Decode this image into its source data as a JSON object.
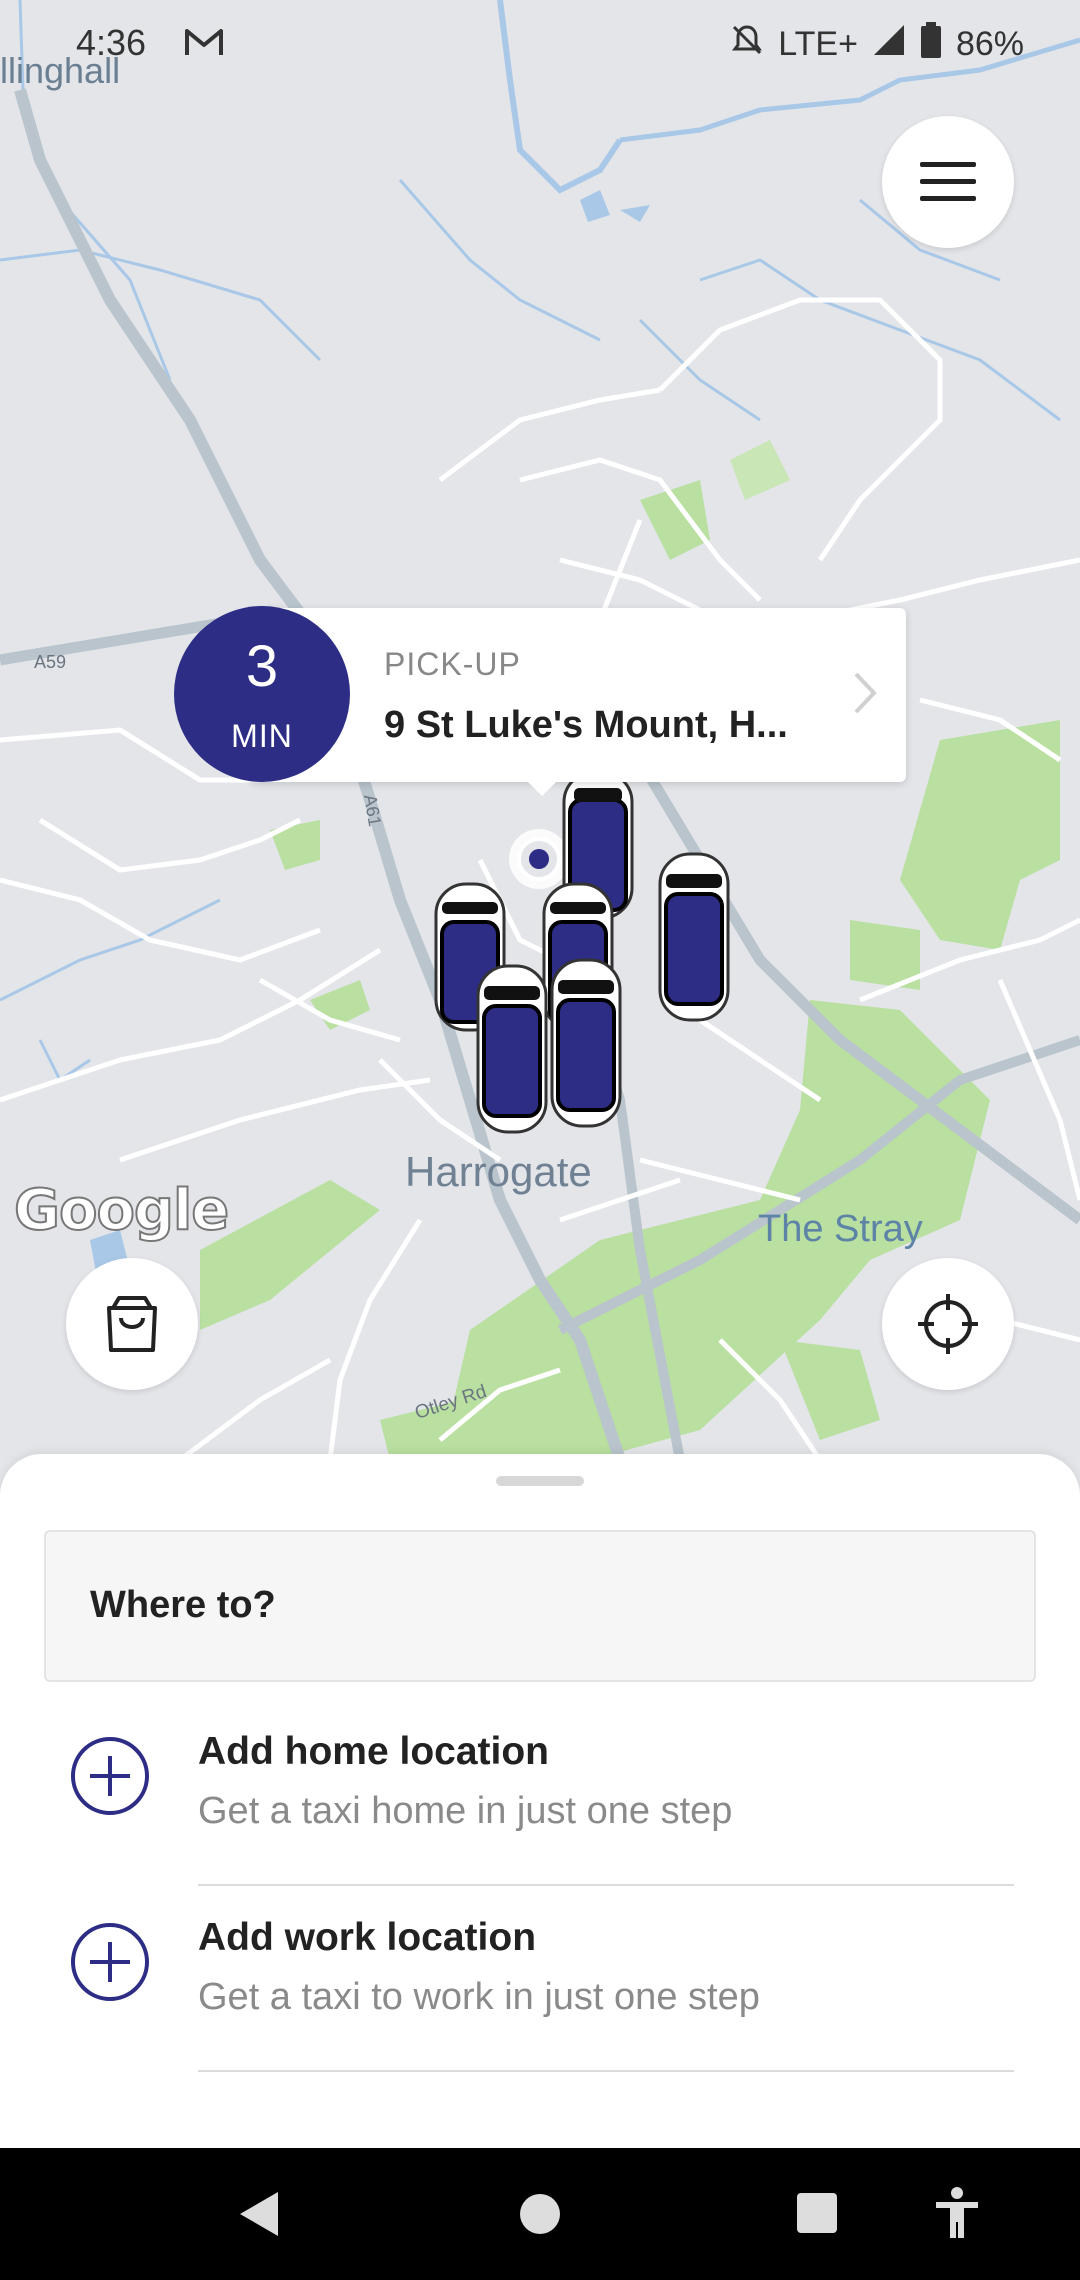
{
  "status_bar": {
    "time": "4:36",
    "gmail_icon": "gmail-icon",
    "network": "LTE+",
    "battery": "86%"
  },
  "map": {
    "labels": {
      "town": "Harrogate",
      "park": "The Stray",
      "village": "llinghall",
      "road_a59": "A59",
      "road_a61": "A61",
      "road_otley": "Otley Rd"
    },
    "attribution": "Google",
    "colors": {
      "land": "#e3e5e9",
      "park": "#b9e0a0",
      "water": "#a9c8e8",
      "road": "#ffffff",
      "major_road": "#b9c4cc"
    }
  },
  "pickup": {
    "eta_value": "3",
    "eta_unit": "MIN",
    "label": "PICK-UP",
    "address": "9 St Luke's Mount, H..."
  },
  "buttons": {
    "menu_icon": "hamburger-menu-icon",
    "shop_icon": "shopping-bag-icon",
    "locate_icon": "crosshair-locate-icon"
  },
  "sheet": {
    "search_placeholder": "Where to?",
    "items": [
      {
        "title": "Add home location",
        "subtitle": "Get a taxi home in just one step",
        "icon": "plus-circle-icon"
      },
      {
        "title": "Add work location",
        "subtitle": "Get a taxi to work in just one step",
        "icon": "plus-circle-icon"
      }
    ]
  },
  "nav": {
    "back": "back-icon",
    "home": "home-icon",
    "recents": "recents-icon",
    "accessibility": "accessibility-icon"
  },
  "theme": {
    "accent": "#2d2d86"
  }
}
